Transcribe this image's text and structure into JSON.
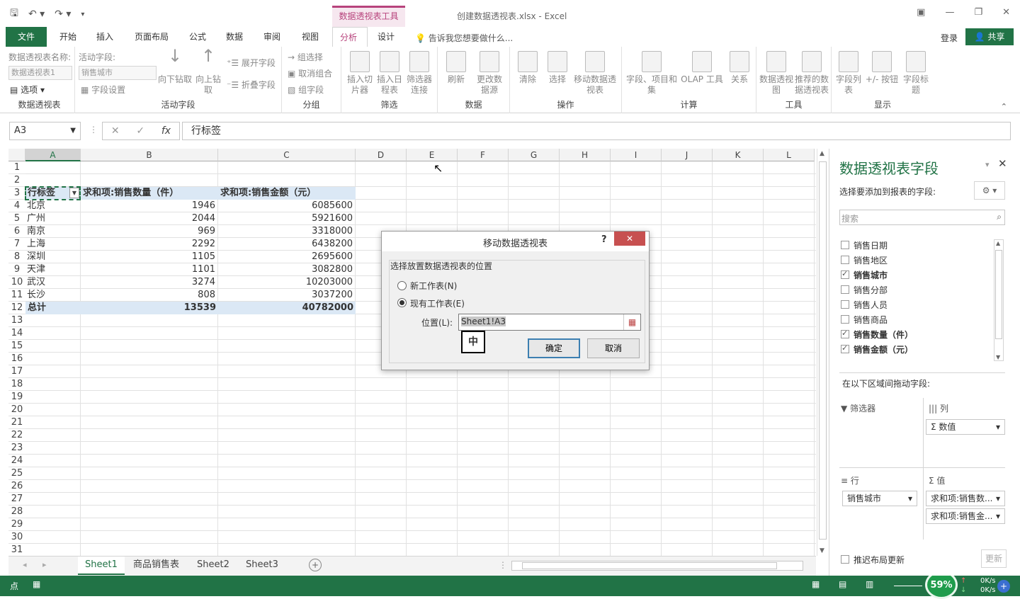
{
  "window": {
    "title": "创建数据透视表.xlsx - Excel",
    "context_tab_group": "数据透视表工具",
    "login": "登录",
    "share": "共享"
  },
  "tabs": [
    "文件",
    "开始",
    "插入",
    "页面布局",
    "公式",
    "数据",
    "审阅",
    "视图",
    "分析",
    "设计"
  ],
  "tell_me": "告诉我您想要做什么...",
  "ribbon": {
    "pivot": {
      "name_label": "数据透视表名称:",
      "name_value": "数据透视表1",
      "options": "选项",
      "group": "数据透视表"
    },
    "active_field": {
      "label": "活动字段:",
      "value": "销售城市",
      "settings": "字段设置",
      "drill_down": "向下钻取",
      "drill_up": "向上钻取",
      "expand": "展开字段",
      "collapse": "折叠字段",
      "group": "活动字段"
    },
    "grouping": {
      "group_sel": "组选择",
      "ungroup": "取消组合",
      "group_field": "组字段",
      "group": "分组"
    },
    "filter": {
      "slicer": "插入切片器",
      "timeline": "插入日程表",
      "connections": "筛选器连接",
      "group": "筛选"
    },
    "data": {
      "refresh": "刷新",
      "change_source": "更改数据源",
      "group": "数据"
    },
    "actions": {
      "clear": "清除",
      "select": "选择",
      "move": "移动数据透视表",
      "group": "操作"
    },
    "calc": {
      "fields_items": "字段、项目和集",
      "olap": "OLAP 工具",
      "relations": "关系",
      "group": "计算"
    },
    "tools": {
      "pivotchart": "数据透视图",
      "recommended": "推荐的数据透视表",
      "group": "工具"
    },
    "show": {
      "field_list": "字段列表",
      "buttons": "+/- 按钮",
      "headers": "字段标题",
      "group": "显示"
    }
  },
  "formula_bar": {
    "name_box": "A3",
    "formula": "行标签"
  },
  "columns": [
    "A",
    "B",
    "C",
    "D",
    "E",
    "F",
    "G",
    "H",
    "I",
    "J",
    "K",
    "L"
  ],
  "rows": [
    "1",
    "2",
    "3",
    "4",
    "5",
    "6",
    "7",
    "8",
    "9",
    "10",
    "11",
    "12",
    "13",
    "14",
    "15",
    "16",
    "17",
    "18",
    "19",
    "20",
    "21",
    "22",
    "23",
    "24",
    "25",
    "26",
    "27",
    "28",
    "29",
    "30",
    "31"
  ],
  "pivot_table": {
    "headers": [
      "行标签",
      "求和项:销售数量（件）",
      "求和项:销售金额（元）"
    ],
    "data": [
      [
        "北京",
        "1946",
        "6085600"
      ],
      [
        "广州",
        "2044",
        "5921600"
      ],
      [
        "南京",
        "969",
        "3318000"
      ],
      [
        "上海",
        "2292",
        "6438200"
      ],
      [
        "深圳",
        "1105",
        "2695600"
      ],
      [
        "天津",
        "1101",
        "3082800"
      ],
      [
        "武汉",
        "3274",
        "10203000"
      ],
      [
        "长沙",
        "808",
        "3037200"
      ]
    ],
    "total": [
      "总计",
      "13539",
      "40782000"
    ]
  },
  "sheets": [
    "Sheet1",
    "商品销售表",
    "Sheet2",
    "Sheet3"
  ],
  "status": {
    "ready": "点",
    "zoom": "59%",
    "up": "0K/s",
    "down": "0K/s"
  },
  "dialog": {
    "title": "移动数据透视表",
    "help": "?",
    "section": "选择放置数据透视表的位置",
    "opt_new": "新工作表(N)",
    "opt_existing": "现有工作表(E)",
    "location_label": "位置(L):",
    "location_value": "Sheet1!A3",
    "ime": "中",
    "ok": "确定",
    "cancel": "取消"
  },
  "field_pane": {
    "title": "数据透视表字段",
    "subtitle": "选择要添加到报表的字段:",
    "search_placeholder": "搜索",
    "fields": [
      {
        "name": "销售日期",
        "checked": false
      },
      {
        "name": "销售地区",
        "checked": false
      },
      {
        "name": "销售城市",
        "checked": true
      },
      {
        "name": "销售分部",
        "checked": false
      },
      {
        "name": "销售人员",
        "checked": false
      },
      {
        "name": "销售商品",
        "checked": false
      },
      {
        "name": "销售数量（件）",
        "checked": true
      },
      {
        "name": "销售金额（元）",
        "checked": true
      }
    ],
    "drag_label": "在以下区域间拖动字段:",
    "filters": "筛选器",
    "columns": "列",
    "columns_item": "Σ 数值",
    "rows": "行",
    "rows_item": "销售城市",
    "values": "值",
    "values_items": [
      "求和项:销售数...",
      "求和项:销售金..."
    ],
    "defer": "推迟布局更新",
    "update": "更新"
  },
  "colors": {
    "accent": "#217346",
    "context": "#b7437c",
    "selection": "#dbe8f5"
  }
}
